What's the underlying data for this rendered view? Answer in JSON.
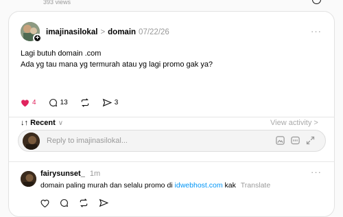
{
  "top": {
    "views": "393 views"
  },
  "post": {
    "author": "imajinasilokal",
    "separator": ">",
    "community": "domain",
    "date": "07/22/26",
    "more": "···",
    "lines": [
      "Lagi butuh domain .com",
      "Ada yg tau mana yg termurah atau yg lagi promo gak ya?"
    ],
    "likes": "4",
    "comments": "13",
    "shares": "3",
    "plus": "+"
  },
  "sort": {
    "label": "Recent",
    "arrow": "↓↑",
    "chevron": "∨",
    "view_activity": "View activity >"
  },
  "reply": {
    "placeholder": "Reply to imajinasilokal..."
  },
  "comment": {
    "author": "fairysunset_",
    "time": "1m",
    "more": "···",
    "text_before": "domain paling murah dan selalu promo di ",
    "link": "idwebhost.com",
    "text_after": " kak",
    "translate": "Translate"
  },
  "colors": {
    "like": "#e0245e",
    "link": "#0095f6",
    "muted": "#999999"
  }
}
